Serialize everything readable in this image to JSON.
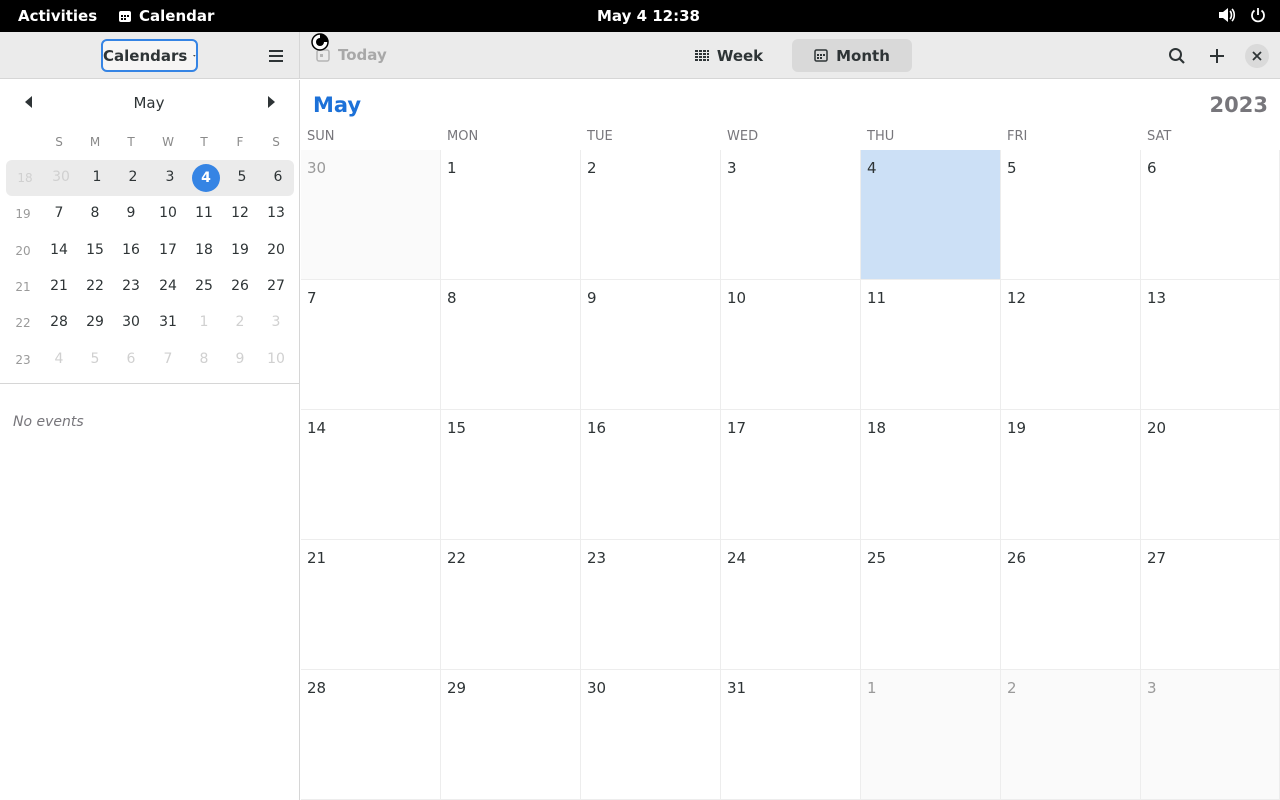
{
  "topbar": {
    "activities": "Activities",
    "app_name": "Calendar",
    "clock": "May 4  12:38"
  },
  "header": {
    "calendars_label": "Calendars",
    "today_label": "Today",
    "week_label": "Week",
    "month_label": "Month"
  },
  "sidebar": {
    "month": "May",
    "weekday_heads": [
      "S",
      "M",
      "T",
      "W",
      "T",
      "F",
      "S"
    ],
    "weeks": [
      {
        "num": "18",
        "days": [
          "30",
          "1",
          "2",
          "3",
          "4",
          "5",
          "6"
        ]
      },
      {
        "num": "19",
        "days": [
          "7",
          "8",
          "9",
          "10",
          "11",
          "12",
          "13"
        ]
      },
      {
        "num": "20",
        "days": [
          "14",
          "15",
          "16",
          "17",
          "18",
          "19",
          "20"
        ]
      },
      {
        "num": "21",
        "days": [
          "21",
          "22",
          "23",
          "24",
          "25",
          "26",
          "27"
        ]
      },
      {
        "num": "22",
        "days": [
          "28",
          "29",
          "30",
          "31",
          "1",
          "2",
          "3"
        ]
      },
      {
        "num": "23",
        "days": [
          "4",
          "5",
          "6",
          "7",
          "8",
          "9",
          "10"
        ]
      }
    ],
    "no_events": "No events"
  },
  "main": {
    "month": "May",
    "year": "2023",
    "weekdays": [
      "SUN",
      "MON",
      "TUE",
      "WED",
      "THU",
      "FRI",
      "SAT"
    ],
    "weeks": [
      [
        "30",
        "1",
        "2",
        "3",
        "4",
        "5",
        "6"
      ],
      [
        "7",
        "8",
        "9",
        "10",
        "11",
        "12",
        "13"
      ],
      [
        "14",
        "15",
        "16",
        "17",
        "18",
        "19",
        "20"
      ],
      [
        "21",
        "22",
        "23",
        "24",
        "25",
        "26",
        "27"
      ],
      [
        "28",
        "29",
        "30",
        "31",
        "1",
        "2",
        "3"
      ]
    ]
  },
  "colors": {
    "accent": "#3584e4",
    "today_cell": "#cce0f6",
    "month_title": "#1c71d8"
  }
}
